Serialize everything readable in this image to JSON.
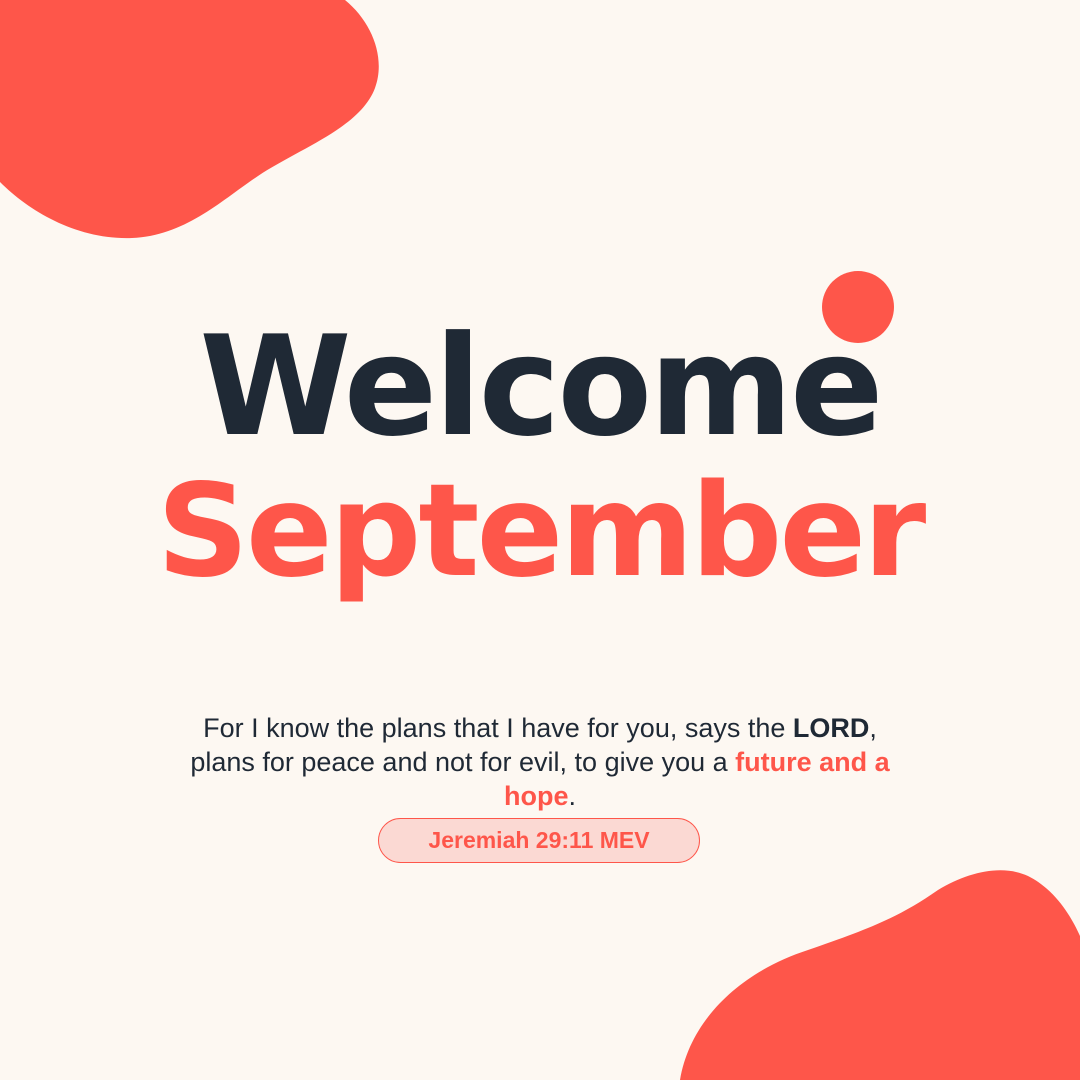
{
  "colors": {
    "background": "#fdf8f2",
    "accent": "#fe564a",
    "dark": "#1f2935",
    "pill_background": "#fbd9d3"
  },
  "headline": {
    "line1": "Welcome",
    "line2": "September"
  },
  "verse": {
    "part1": "For I know the plans that I have for you, says the ",
    "lord": "LORD",
    "part2": ", plans for peace and not for evil, to give you a ",
    "highlight": "future and a hope",
    "part3": "."
  },
  "reference": "Jeremiah 29:11 MEV"
}
